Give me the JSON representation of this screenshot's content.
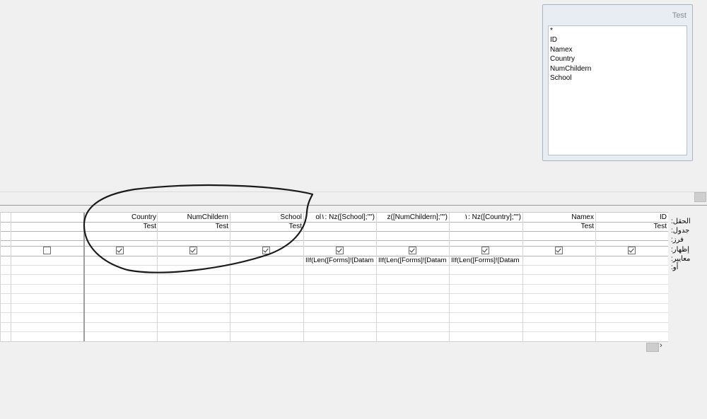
{
  "table_box": {
    "title": "Test",
    "fields": [
      "*",
      "ID",
      "Namex",
      "Country",
      "NumChildern",
      "School"
    ]
  },
  "row_labels": {
    "field": "الحقل:",
    "table": "جدول:",
    "sort": "فرز:",
    "show": "إظهار:",
    "criteria": "معايير:",
    "or": "أو:"
  },
  "grid": {
    "columns": [
      {
        "field": "ID",
        "table": "Test",
        "show": true,
        "criteria": ""
      },
      {
        "field": "Namex",
        "table": "Test",
        "show": true,
        "criteria": ""
      },
      {
        "field": "١: Nz([Country];\"\")",
        "table": "",
        "show": true,
        "criteria": "IIf(Len([Forms]![Datam"
      },
      {
        "field": "z([NumChildern];\"\")",
        "table": "",
        "show": true,
        "criteria": "IIf(Len([Forms]![Datam"
      },
      {
        "field": "ol١: Nz([School];\"\")",
        "table": "",
        "show": true,
        "criteria": "IIf(Len([Forms]![Datam"
      },
      {
        "field": "School",
        "table": "Test",
        "show": true,
        "criteria": ""
      },
      {
        "field": "NumChildern",
        "table": "Test",
        "show": true,
        "criteria": ""
      },
      {
        "field": "Country",
        "table": "Test",
        "show": true,
        "criteria": ""
      },
      {
        "field": "",
        "table": "",
        "show": false,
        "criteria": ""
      },
      {
        "field": "",
        "table": "",
        "show": null,
        "criteria": ""
      }
    ]
  },
  "scrollbar": {
    "arrow": "›"
  }
}
